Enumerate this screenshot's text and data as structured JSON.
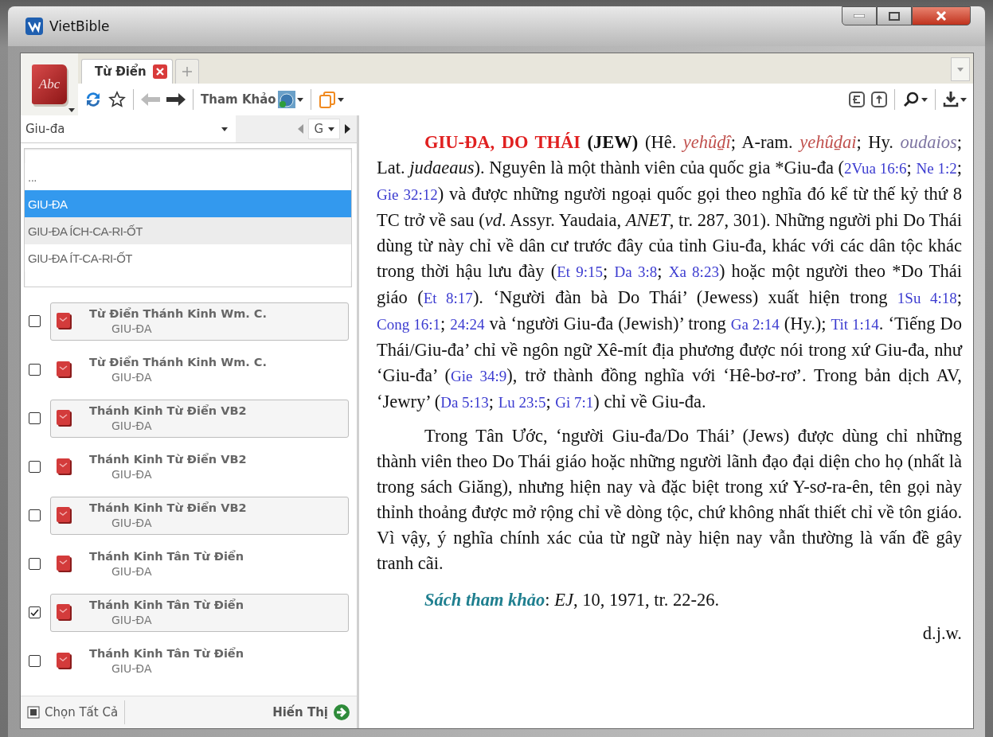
{
  "window": {
    "title": "VietBible"
  },
  "app_logo": {
    "text": "Abc"
  },
  "tabs": [
    {
      "label": "Từ Điển",
      "selected": true,
      "closable": true
    }
  ],
  "toolbar": {
    "reference_label": "Tham Khảo"
  },
  "search": {
    "value": "Giu-đa",
    "letter": "G"
  },
  "suggestions": [
    {
      "text": "...",
      "selected": false,
      "hovered": false
    },
    {
      "text": "GIU-ĐA",
      "selected": true,
      "hovered": false
    },
    {
      "text": "GIU-ĐA ÍCH-CA-RI-ỐT",
      "selected": false,
      "hovered": true
    },
    {
      "text": "GIU-ĐA ÍT-CA-RI-ỐT",
      "selected": false,
      "hovered": false
    }
  ],
  "results": [
    {
      "title": "Từ Điển Thánh Kinh Wm. C.",
      "entry": "GIU-ĐA",
      "checked": false,
      "highlighted": true
    },
    {
      "title": "Từ Điển Thánh Kinh Wm. C.",
      "entry": "GIU-ĐA",
      "checked": false,
      "highlighted": false
    },
    {
      "title": "Thánh Kinh Từ Điển VB2",
      "entry": "GIU-ĐA",
      "checked": false,
      "highlighted": true
    },
    {
      "title": "Thánh Kinh Từ Điển VB2",
      "entry": "GIU-ĐA",
      "checked": false,
      "highlighted": false
    },
    {
      "title": "Thánh Kinh Từ Điển VB2",
      "entry": "GIU-ĐA",
      "checked": false,
      "highlighted": true
    },
    {
      "title": "Thánh Kinh Tân Từ Điển",
      "entry": "GIU-ĐA",
      "checked": false,
      "highlighted": false
    },
    {
      "title": "Thánh Kinh Tân Từ Điển",
      "entry": "GIU-ĐA",
      "checked": true,
      "highlighted": true
    },
    {
      "title": "Thánh Kinh Tân Từ Điển",
      "entry": "GIU-ĐA",
      "checked": false,
      "highlighted": false
    }
  ],
  "footer": {
    "select_all": "Chọn Tất Cả",
    "show": "Hiến Thị"
  },
  "article": {
    "paragraphs": [
      {
        "kind": "body",
        "segments": [
          {
            "kind": "headword",
            "text": "GIU-ĐA, DO THÁI"
          },
          {
            "kind": "bold",
            "text": " (JEW)"
          },
          {
            "kind": "text",
            "text": " (Hê. "
          },
          {
            "kind": "foreign",
            "text": "yehûḏî",
            "color": "#c0504d"
          },
          {
            "kind": "text",
            "text": "; A-ram. "
          },
          {
            "kind": "foreign",
            "text": "yehûḏai",
            "color": "#c0504d"
          },
          {
            "kind": "text",
            "text": "; Hy. "
          },
          {
            "kind": "foreign",
            "text": "oudaios",
            "color": "#7f76a3"
          },
          {
            "kind": "text",
            "text": "; Lat. "
          },
          {
            "kind": "italic",
            "text": "judaeaus"
          },
          {
            "kind": "text",
            "text": "). Nguyên là một thành viên của quốc gia *Giu-đa ("
          },
          {
            "kind": "link",
            "text": "2Vua 16:6"
          },
          {
            "kind": "text",
            "text": "; "
          },
          {
            "kind": "link",
            "text": "Ne 1:2"
          },
          {
            "kind": "text",
            "text": "; "
          },
          {
            "kind": "link",
            "text": "Gie 32:12"
          },
          {
            "kind": "text",
            "text": ") và được những người ngoại quốc gọi theo nghĩa đó kể từ thế kỷ thứ 8 TC trở về sau ("
          },
          {
            "kind": "italic",
            "text": "vd"
          },
          {
            "kind": "text",
            "text": ". Assyr. Yaudaia, "
          },
          {
            "kind": "italic",
            "text": "ANET"
          },
          {
            "kind": "text",
            "text": ", tr. 287, 301). Những người phi Do Thái dùng từ này chỉ về dân cư trước đây của tỉnh Giu-đa, khác với các dân tộc khác trong thời hậu lưu đày ("
          },
          {
            "kind": "link",
            "text": "Et 9:15"
          },
          {
            "kind": "text",
            "text": "; "
          },
          {
            "kind": "link",
            "text": "Da 3:8"
          },
          {
            "kind": "text",
            "text": "; "
          },
          {
            "kind": "link",
            "text": "Xa 8:23"
          },
          {
            "kind": "text",
            "text": ") hoặc một người theo *Do Thái giáo ("
          },
          {
            "kind": "link",
            "text": "Et 8:17"
          },
          {
            "kind": "text",
            "text": "). ‘Người đàn bà Do Thái’ (Jewess) xuất hiện trong "
          },
          {
            "kind": "link",
            "text": "1Su 4:18"
          },
          {
            "kind": "text",
            "text": "; "
          },
          {
            "kind": "link",
            "text": "Cong 16:1"
          },
          {
            "kind": "text",
            "text": "; "
          },
          {
            "kind": "link",
            "text": "24:24"
          },
          {
            "kind": "text",
            "text": " và ‘người Giu-đa (Jewish)’ trong "
          },
          {
            "kind": "link",
            "text": "Ga 2:14"
          },
          {
            "kind": "text",
            "text": " (Hy.); "
          },
          {
            "kind": "link",
            "text": "Tit 1:14"
          },
          {
            "kind": "text",
            "text": ". ‘Tiếng Do Thái/Giu-đa’ chỉ về ngôn ngữ Xê-mít địa phương được nói trong xứ Giu-đa, như ‘Giu-đa’ ("
          },
          {
            "kind": "link",
            "text": "Gie 34:9"
          },
          {
            "kind": "text",
            "text": "), trở thành đồng nghĩa với ‘Hê-bơ-rơ’. Trong bản dịch AV, ‘Jewry’ ("
          },
          {
            "kind": "link",
            "text": "Da 5:13"
          },
          {
            "kind": "text",
            "text": "; "
          },
          {
            "kind": "link",
            "text": "Lu 23:5"
          },
          {
            "kind": "text",
            "text": "; "
          },
          {
            "kind": "link",
            "text": "Gi 7:1"
          },
          {
            "kind": "text",
            "text": ") chỉ về Giu-đa."
          }
        ]
      },
      {
        "kind": "body",
        "segments": [
          {
            "kind": "text",
            "text": "Trong Tân Ước, ‘người Giu-đa/Do Thái’ (Jews) được dùng chỉ những thành viên theo Do Thái giáo hoặc những người lãnh đạo đại diện cho họ (nhất là trong sách Giăng), nhưng hiện nay và đặc biệt trong xứ Y-sơ-ra-ên, tên gọi này thỉnh thoảng được mở rộng chỉ về dòng tộc, chứ không nhất thiết chỉ về tôn giáo. Vì vậy, ý nghĩa chính xác của từ ngữ này hiện nay vẫn thường là vấn đề gây tranh cãi."
          }
        ]
      },
      {
        "kind": "reference",
        "segments": [
          {
            "kind": "label",
            "text": "Sách tham khảo"
          },
          {
            "kind": "text",
            "text": ": "
          },
          {
            "kind": "italic",
            "text": "EJ"
          },
          {
            "kind": "text",
            "text": ", 10, 1971, tr. 22-26."
          }
        ]
      },
      {
        "kind": "signature",
        "segments": [
          {
            "kind": "text",
            "text": "d.j.w."
          }
        ]
      }
    ]
  }
}
